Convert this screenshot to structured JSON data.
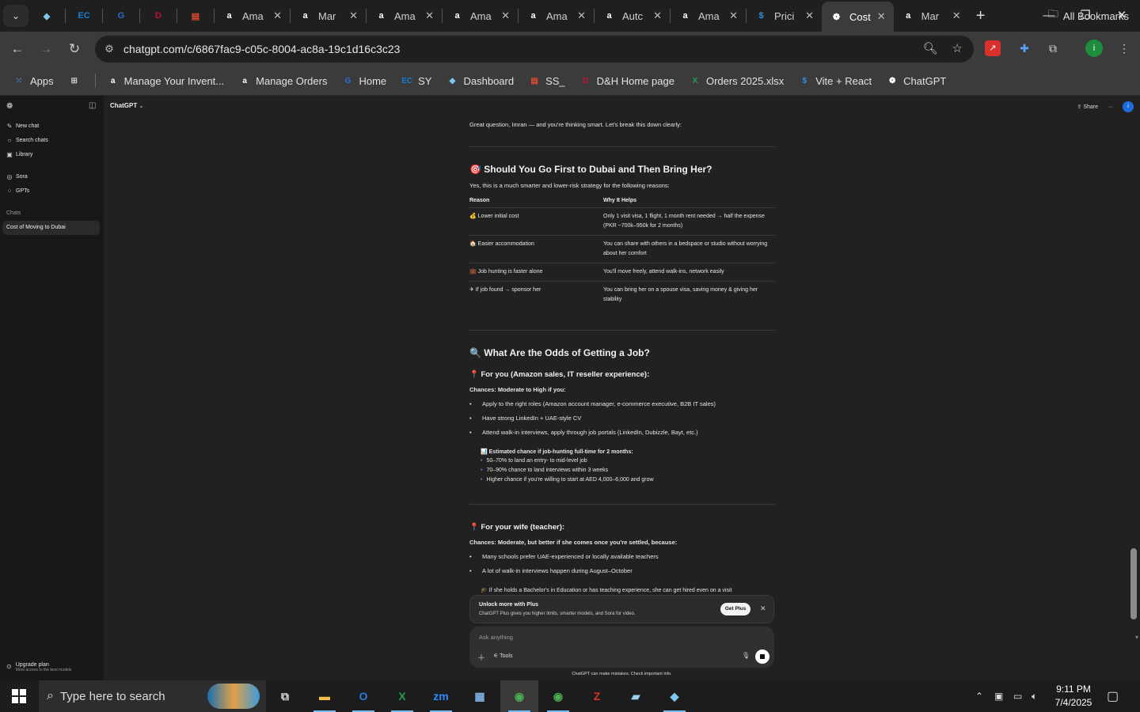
{
  "browser": {
    "tabs": [
      {
        "title": "",
        "icon": "diamond-icon",
        "color": "#7cc8f0",
        "kind": "small"
      },
      {
        "title": "",
        "icon": "ec-icon",
        "color": "#1a7bd6",
        "kind": "small"
      },
      {
        "title": "",
        "icon": "g-icon",
        "color": "#2b6cd6",
        "kind": "small"
      },
      {
        "title": "",
        "icon": "dh-icon",
        "color": "#c8102e",
        "kind": "small"
      },
      {
        "title": "",
        "icon": "stack-icon",
        "color": "#e24a2e",
        "kind": "small"
      },
      {
        "title": "Ama",
        "icon": "amazon-icon",
        "color": "#ffffff",
        "kind": "normal"
      },
      {
        "title": "Mar",
        "icon": "amazon-icon",
        "color": "#ffffff",
        "kind": "normal"
      },
      {
        "title": "Ama",
        "icon": "amazon-icon",
        "color": "#ffffff",
        "kind": "normal"
      },
      {
        "title": "Ama",
        "icon": "amazon-icon",
        "color": "#ffffff",
        "kind": "normal"
      },
      {
        "title": "Ama",
        "icon": "amazon-icon",
        "color": "#ffffff",
        "kind": "normal"
      },
      {
        "title": "Autc",
        "icon": "amazon-icon",
        "color": "#ffffff",
        "kind": "normal"
      },
      {
        "title": "Ama",
        "icon": "amazon-icon",
        "color": "#ffffff",
        "kind": "normal"
      },
      {
        "title": "Prici",
        "icon": "dollar-icon",
        "color": "#2e8fe0",
        "kind": "normal"
      },
      {
        "title": "Cost",
        "icon": "openai-icon",
        "color": "#ffffff",
        "kind": "active"
      },
      {
        "title": "Mar",
        "icon": "amazon-icon",
        "color": "#ffffff",
        "kind": "normal"
      }
    ],
    "url": "chatgpt.com/c/6867fac9-c05c-8004-ac8a-19c1d16c3c23",
    "bookmarks": [
      {
        "label": "Apps",
        "icon": "apps-grid-icon",
        "color": "#4a90e2"
      },
      {
        "label": "",
        "icon": "tab-groups-icon",
        "color": "#cccccc"
      },
      {
        "label": "Manage Your Invent...",
        "icon": "amazon-icon",
        "color": "#ffffff"
      },
      {
        "label": "Manage Orders",
        "icon": "amazon-icon",
        "color": "#ffffff"
      },
      {
        "label": "Home",
        "icon": "g-icon",
        "color": "#2b6cd6"
      },
      {
        "label": "SY",
        "icon": "ec-icon",
        "color": "#1a7bd6"
      },
      {
        "label": "Dashboard",
        "icon": "diamond-icon",
        "color": "#7cc8f0"
      },
      {
        "label": "SS_",
        "icon": "stack-icon",
        "color": "#e24a2e"
      },
      {
        "label": "D&H Home page",
        "icon": "dh-icon",
        "color": "#c8102e"
      },
      {
        "label": "Orders 2025.xlsx",
        "icon": "excel-icon",
        "color": "#1f9d55"
      },
      {
        "label": "Vite + React",
        "icon": "dollar-icon",
        "color": "#2e8fe0"
      },
      {
        "label": "ChatGPT",
        "icon": "openai-icon",
        "color": "#ffffff"
      }
    ],
    "all_bookmarks": "All Bookmarks"
  },
  "sidebar": {
    "items": [
      {
        "label": "New chat",
        "icon": "compose-icon"
      },
      {
        "label": "Search chats",
        "icon": "search-icon"
      },
      {
        "label": "Library",
        "icon": "library-icon"
      },
      {
        "label": "Sora",
        "icon": "sora-icon"
      },
      {
        "label": "GPTs",
        "icon": "gpts-icon"
      }
    ],
    "chats_label": "Chats",
    "active_chat": "Cost of Moving to Dubai",
    "upgrade_title": "Upgrade plan",
    "upgrade_sub": "More access to the best models"
  },
  "header": {
    "model": "ChatGPT",
    "share": "Share",
    "avatar": "i"
  },
  "message": {
    "intro": "Great question, Imran — and you're thinking smart. Let's break this down clearly:",
    "section1_title": "🎯 Should You Go First to Dubai and Then Bring Her?",
    "section1_lead": "Yes, this is a much smarter and lower-risk strategy for the following reasons:",
    "table": {
      "headers": [
        "Reason",
        "Why It Helps"
      ],
      "rows": [
        [
          "💰 Lower initial cost",
          "Only 1 visit visa, 1 flight, 1 month rent needed → half the expense (PKR ~700k–950k for 2 months)"
        ],
        [
          "🏠 Easier accommodation",
          "You can share with others in a bedspace or studio without worrying about her comfort"
        ],
        [
          "💼 Job hunting is faster alone",
          "You'll move freely, attend walk-ins, network easily"
        ],
        [
          "✈ If job found → sponsor her",
          "You can bring her on a spouse visa, saving money & giving her stability"
        ]
      ]
    },
    "section2_title": "🔍 What Are the Odds of Getting a Job?",
    "you_title": "📍 For you (Amazon sales, IT reseller experience):",
    "you_chances": "Chances: Moderate to High if you:",
    "you_bullets": [
      "Apply to the right roles (Amazon account manager, e-commerce executive, B2B IT sales)",
      "Have strong LinkedIn + UAE-style CV",
      "Attend walk-in interviews, apply through job portals (LinkedIn, Dubizzle, Bayt, etc.)"
    ],
    "estimate_title": "📊 Estimated chance if job-hunting full-time for 2 months:",
    "estimate_bullets": [
      "50–70% to land an entry- to mid-level job",
      "70–90% chance to land interviews within 3 weeks",
      "Higher chance if you're willing to start at AED 4,000–6,000 and grow"
    ],
    "wife_title": "📍 For your wife (teacher):",
    "wife_chances": "Chances: Moderate, but better if she comes once you're settled, because:",
    "wife_bullets": [
      "Many schools prefer UAE-experienced or locally available teachers",
      "A lot of walk-in interviews happen during August–October"
    ],
    "wife_sub": "🎓 If she holds a Bachelor's in Education or has teaching experience, she can get hired even on a visit"
  },
  "upsell": {
    "title": "Unlock more with Plus",
    "text": "ChatGPT Plus gives you higher limits, smarter models, and Sora for video.",
    "button": "Get Plus"
  },
  "composer": {
    "placeholder": "Ask anything",
    "tools": "Tools"
  },
  "disclaimer": "ChatGPT can make mistakes. Check important info.",
  "taskbar": {
    "search_placeholder": "Type here to search",
    "time": "9:11 PM",
    "date": "7/4/2025"
  }
}
